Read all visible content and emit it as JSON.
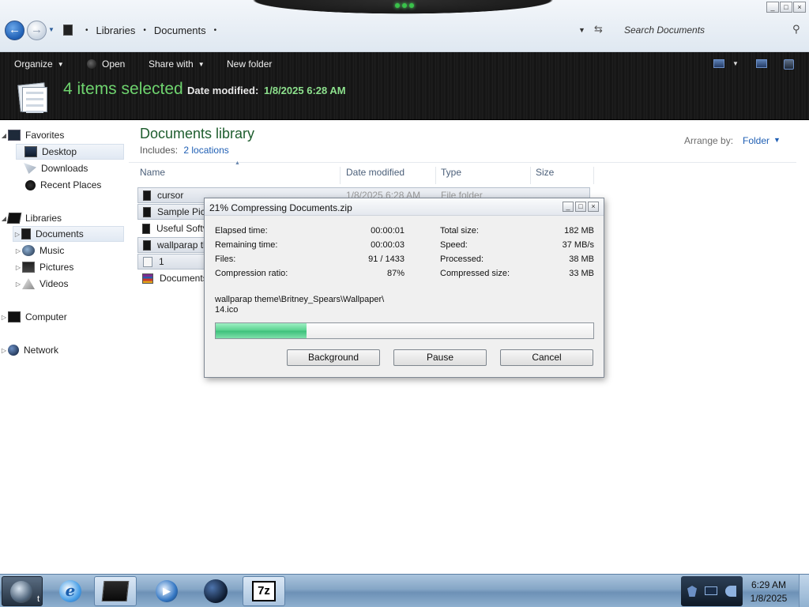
{
  "window": {
    "minimize_glyph": "_",
    "maximize_glyph": "□",
    "close_glyph": "×"
  },
  "address": {
    "back_glyph": "←",
    "forward_glyph": "→",
    "breadcrumb": [
      "Libraries",
      "Documents"
    ],
    "separator": "•",
    "search_placeholder": "Search Documents"
  },
  "toolbar": {
    "organize": "Organize",
    "open": "Open",
    "share_with": "Share with",
    "new_folder": "New folder"
  },
  "details": {
    "selection": "4 items selected",
    "date_modified_label": "Date modified:",
    "date_modified_value": "1/8/2025 6:28 AM"
  },
  "navigation": {
    "favorites": "Favorites",
    "desktop": "Desktop",
    "downloads": "Downloads",
    "recent_places": "Recent Places",
    "libraries": "Libraries",
    "documents": "Documents",
    "music": "Music",
    "pictures": "Pictures",
    "videos": "Videos",
    "computer": "Computer",
    "network": "Network"
  },
  "library": {
    "title": "Documents library",
    "includes_label": "Includes:",
    "includes_link": "2 locations",
    "arrange_label": "Arrange by:",
    "arrange_value": "Folder"
  },
  "columns": {
    "name": "Name",
    "date_modified": "Date modified",
    "type": "Type",
    "size": "Size"
  },
  "files": [
    {
      "name": "cursor",
      "date": "1/8/2025 6:28 AM",
      "type": "File folder",
      "icon": "folder-icon"
    },
    {
      "name": "Sample Pict",
      "date": "",
      "type": "",
      "icon": "folder-icon"
    },
    {
      "name": "Useful Softv",
      "date": "",
      "type": "",
      "icon": "folder-icon"
    },
    {
      "name": "wallparap th",
      "date": "",
      "type": "",
      "icon": "folder-icon"
    },
    {
      "name": "1",
      "date": "",
      "type": "",
      "icon": "text-file-icon"
    },
    {
      "name": "Documents",
      "date": "",
      "type": "",
      "icon": "archive-icon"
    }
  ],
  "dialog": {
    "title": "21% Compressing Documents.zip",
    "elapsed_label": "Elapsed time:",
    "elapsed_value": "00:00:01",
    "remaining_label": "Remaining time:",
    "remaining_value": "00:00:03",
    "files_label": "Files:",
    "files_value": "91 / 1433",
    "ratio_label": "Compression ratio:",
    "ratio_value": "87%",
    "total_label": "Total size:",
    "total_value": "182 MB",
    "speed_label": "Speed:",
    "speed_value": "37 MB/s",
    "processed_label": "Processed:",
    "processed_value": "38 MB",
    "compressed_label": "Compressed size:",
    "compressed_value": "33 MB",
    "current_path_line1": "wallparap theme\\Britney_Spears\\Wallpaper\\",
    "current_path_line2": "14.ico",
    "progress_fraction": 0.24,
    "background_button": "Background",
    "pause_button": "Pause",
    "cancel_button": "Cancel"
  },
  "taskbar": {
    "start_label": "t",
    "ie_glyph": "e",
    "sevenzip_label": "7z",
    "wmp_glyph": "▶",
    "clock_time": "6:29 AM",
    "clock_date": "1/8/2025"
  },
  "colors": {
    "accent_green": "#6ed36e",
    "link_blue": "#1f5fb4",
    "progress_green": "#56d08d"
  }
}
